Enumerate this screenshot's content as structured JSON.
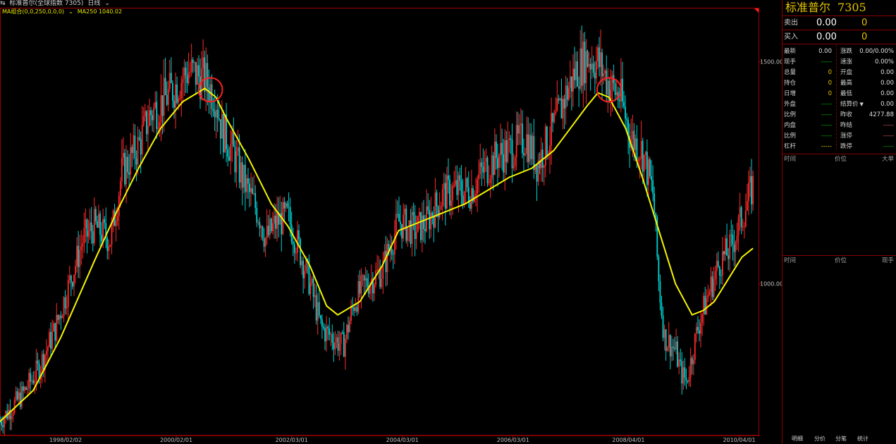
{
  "topbar": {
    "icon": "switch-icon",
    "title": "标准普尔(全球指数 7305)",
    "period": "日线",
    "period_caret": "chevron-down-icon"
  },
  "ma_legend": {
    "label": "MA组合(0,0,250,0,0,0)",
    "ma250": "MA250 1040.02"
  },
  "colors": {
    "up": "#ff2a2a",
    "down": "#00d2d2",
    "ma": "#f5f500",
    "border": "#a00000",
    "circle": "#ff2020"
  },
  "chart_data": {
    "type": "line",
    "title": "",
    "xlabel": "",
    "ylabel": "",
    "x_tick_labels": [
      "1998/02/02",
      "2000/02/01",
      "2002/03/01",
      "2004/03/01",
      "2006/03/01",
      "2008/04/01",
      "2010/04/01"
    ],
    "y_tick_labels": [
      "1500.00",
      "1000.00"
    ],
    "y_ticks": [
      1500,
      1000
    ],
    "ylim": [
      660,
      1620
    ],
    "xlim": [
      1996.9,
      2010.6
    ],
    "grid": false,
    "series": [
      {
        "name": "",
        "style": "candlestick",
        "x": [
          1996.9,
          1997.3,
          1997.6,
          1997.9,
          1998.1,
          1998.4,
          1998.6,
          1998.9,
          1999.1,
          1999.4,
          1999.6,
          1999.9,
          2000.1,
          2000.3,
          2000.6,
          2000.8,
          2000.9,
          2001.1,
          2001.3,
          2001.6,
          2001.7,
          2001.9,
          2002.1,
          2002.3,
          2002.5,
          2002.7,
          2002.9,
          2003.1,
          2003.3,
          2003.5,
          2003.8,
          2004.1,
          2004.4,
          2004.6,
          2004.9,
          2005.1,
          2005.4,
          2005.6,
          2005.9,
          2006.1,
          2006.4,
          2006.6,
          2006.9,
          2007.1,
          2007.3,
          2007.5,
          2007.7,
          2007.9,
          2008.1,
          2008.3,
          2008.5,
          2008.7,
          2008.8,
          2008.9,
          2009.1,
          2009.2,
          2009.3,
          2009.5,
          2009.7,
          2009.9,
          2010.1,
          2010.3,
          2010.5
        ],
        "values": [
          690,
          750,
          810,
          900,
          980,
          1100,
          1130,
          1100,
          1250,
          1310,
          1380,
          1420,
          1450,
          1480,
          1460,
          1420,
          1350,
          1300,
          1230,
          1150,
          1100,
          1140,
          1150,
          1080,
          1000,
          900,
          880,
          860,
          960,
          1000,
          1030,
          1140,
          1120,
          1140,
          1200,
          1210,
          1210,
          1250,
          1290,
          1300,
          1330,
          1270,
          1350,
          1420,
          1480,
          1510,
          1500,
          1450,
          1420,
          1330,
          1300,
          1200,
          1000,
          880,
          850,
          800,
          780,
          900,
          980,
          1050,
          1080,
          1150,
          1220
        ]
      },
      {
        "name": "",
        "style": "line",
        "x": [
          1996.9,
          1997.5,
          1998.0,
          1998.6,
          1999.0,
          1999.4,
          1999.8,
          2000.2,
          2000.6,
          2000.8,
          2001.0,
          2001.4,
          2001.8,
          2002.1,
          2002.5,
          2002.8,
          2003.0,
          2003.4,
          2003.8,
          2004.1,
          2004.5,
          2004.9,
          2005.3,
          2005.7,
          2006.1,
          2006.5,
          2006.9,
          2007.2,
          2007.5,
          2007.7,
          2007.9,
          2008.2,
          2008.5,
          2008.8,
          2009.1,
          2009.4,
          2009.6,
          2009.8,
          2010.0,
          2010.3,
          2010.5
        ],
        "values": [
          690,
          760,
          880,
          1050,
          1160,
          1260,
          1350,
          1410,
          1440,
          1420,
          1370,
          1280,
          1180,
          1130,
          1040,
          950,
          930,
          960,
          1040,
          1120,
          1140,
          1160,
          1180,
          1210,
          1240,
          1260,
          1300,
          1350,
          1400,
          1430,
          1420,
          1350,
          1240,
          1120,
          1000,
          930,
          940,
          960,
          1000,
          1060,
          1080
        ]
      }
    ],
    "annotations": [
      {
        "type": "circle",
        "x": 2000.7,
        "y": 1437
      },
      {
        "type": "circle",
        "x": 2007.9,
        "y": 1437
      }
    ]
  },
  "quote": {
    "name": "标准普尔",
    "code": "7305",
    "sell_label": "卖出",
    "sell_price": "0.00",
    "sell_vol": "0",
    "buy_label": "买入",
    "buy_price": "0.00",
    "buy_vol": "0",
    "rows": [
      {
        "l1": "最新",
        "v1": "0.00",
        "c1": "#e0e0e0",
        "l2": "涨跌",
        "v2": "0.00/0.00%",
        "c2": "#e0e0e0"
      },
      {
        "l1": "现手",
        "v1": "-----",
        "c1": "#00c000",
        "l2": "速涨",
        "v2": "0.00%",
        "c2": "#e0e0e0"
      },
      {
        "l1": "总量",
        "v1": "0",
        "c1": "#e6c200",
        "l2": "开盘",
        "v2": "0.00",
        "c2": "#e0e0e0"
      },
      {
        "l1": "持仓",
        "v1": "0",
        "c1": "#e6c200",
        "l2": "最高",
        "v2": "0.00",
        "c2": "#e0e0e0"
      },
      {
        "l1": "日增",
        "v1": "0",
        "c1": "#e6c200",
        "l2": "最低",
        "v2": "0.00",
        "c2": "#e0e0e0"
      },
      {
        "l1": "外盘",
        "v1": "-----",
        "c1": "#00c000",
        "l2": "结算价",
        "v2": "0.00",
        "c2": "#e0e0e0"
      },
      {
        "l1": "比例",
        "v1": "-----",
        "c1": "#00c000",
        "l2": "昨收",
        "v2": "4277.88",
        "c2": "#e0e0e0"
      },
      {
        "l1": "内盘",
        "v1": "-----",
        "c1": "#00c000",
        "l2": "昨结",
        "v2": "-----",
        "c2": "#e06060"
      },
      {
        "l1": "比例",
        "v1": "-----",
        "c1": "#00c000",
        "l2": "涨停",
        "v2": "-----",
        "c2": "#e06060"
      },
      {
        "l1": "杠杆",
        "v1": "-----",
        "c1": "#e6c200",
        "l2": "跌停",
        "v2": "-----",
        "c2": "#00c000"
      }
    ],
    "settle_caret": "triangle-down-icon"
  },
  "ticks_panel": {
    "time": "时间",
    "price": "价位",
    "big": "大单"
  },
  "trades_panel": {
    "time": "时间",
    "price": "价位",
    "hand": "现手"
  },
  "tabs": [
    "明细",
    "分价",
    "分笔",
    "统计"
  ]
}
